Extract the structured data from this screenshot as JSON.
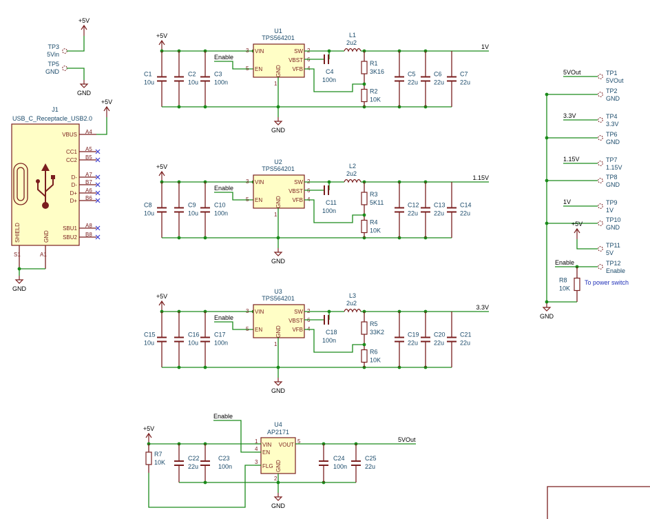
{
  "regulators": [
    {
      "ref": "U1",
      "part": "TPS564201",
      "enable": "Enable",
      "out_net": "1V",
      "l_ref": "L1",
      "l_val": "2u2",
      "cin": [
        {
          "ref": "C1",
          "val": "10u"
        },
        {
          "ref": "C2",
          "val": "10u"
        },
        {
          "ref": "C3",
          "val": "100n"
        }
      ],
      "cboot": {
        "ref": "C4",
        "val": "100n"
      },
      "rtop": {
        "ref": "R1",
        "val": "3K16"
      },
      "rbot": {
        "ref": "R2",
        "val": "10K"
      },
      "cout": [
        {
          "ref": "C5",
          "val": "22u"
        },
        {
          "ref": "C6",
          "val": "22u"
        },
        {
          "ref": "C7",
          "val": "22u"
        }
      ]
    },
    {
      "ref": "U2",
      "part": "TPS564201",
      "enable": "Enable",
      "out_net": "1.15V",
      "l_ref": "L2",
      "l_val": "2u2",
      "cin": [
        {
          "ref": "C8",
          "val": "10u"
        },
        {
          "ref": "C9",
          "val": "10u"
        },
        {
          "ref": "C10",
          "val": "100n"
        }
      ],
      "cboot": {
        "ref": "C11",
        "val": "100n"
      },
      "rtop": {
        "ref": "R3",
        "val": "5K11"
      },
      "rbot": {
        "ref": "R4",
        "val": "10K"
      },
      "cout": [
        {
          "ref": "C12",
          "val": "22u"
        },
        {
          "ref": "C13",
          "val": "22u"
        },
        {
          "ref": "C14",
          "val": "22u"
        }
      ]
    },
    {
      "ref": "U3",
      "part": "TPS564201",
      "enable": "Enable",
      "out_net": "3.3V",
      "l_ref": "L3",
      "l_val": "2u2",
      "cin": [
        {
          "ref": "C15",
          "val": "10u"
        },
        {
          "ref": "C16",
          "val": "10u"
        },
        {
          "ref": "C17",
          "val": "100n"
        }
      ],
      "cboot": {
        "ref": "C18",
        "val": "100n"
      },
      "rtop": {
        "ref": "R5",
        "val": "33K2"
      },
      "rbot": {
        "ref": "R6",
        "val": "10K"
      },
      "cout": [
        {
          "ref": "C19",
          "val": "22u"
        },
        {
          "ref": "C20",
          "val": "22u"
        },
        {
          "ref": "C21",
          "val": "22u"
        }
      ]
    }
  ],
  "reg_pins": {
    "vin": "VIN",
    "en": "EN",
    "sw": "SW",
    "vbst": "VBST",
    "vfb": "VFB",
    "gnd": "GND",
    "n_vin": "3",
    "n_en": "5",
    "n_sw": "2",
    "n_vbst": "6",
    "n_vfb": "4",
    "n_gnd": "1"
  },
  "switch": {
    "ref": "U4",
    "part": "AP2171",
    "enable": "Enable",
    "out_net": "5VOut",
    "pins": {
      "vin": "VIN",
      "en": "EN",
      "flg": "FLG",
      "gnd": "GND",
      "vout": "VOUT",
      "n_vin": "1",
      "n_en": "4",
      "n_flg": "3",
      "n_gnd": "2",
      "n_vout": "5"
    },
    "r": {
      "ref": "R7",
      "val": "10K"
    },
    "cin": [
      {
        "ref": "C22",
        "val": "22u"
      },
      {
        "ref": "C23",
        "val": "100n"
      }
    ],
    "cout": [
      {
        "ref": "C24",
        "val": "100n"
      },
      {
        "ref": "C25",
        "val": "22u"
      }
    ]
  },
  "power": {
    "p5v": "+5V",
    "gnd": "GND"
  },
  "top_tps": [
    {
      "ref": "TP3",
      "val": "5Vin"
    },
    {
      "ref": "TP5",
      "val": "GND"
    }
  ],
  "usb": {
    "ref": "J1",
    "part": "USB_C_Receptacle_USB2.0",
    "pins": [
      {
        "name": "VBUS",
        "num": "A4"
      },
      {
        "name": "CC1",
        "num": "A5"
      },
      {
        "name": "CC2",
        "num": "B5"
      },
      {
        "name": "D-",
        "num": "A7"
      },
      {
        "name": "D-",
        "num": "B7"
      },
      {
        "name": "D+",
        "num": "A6"
      },
      {
        "name": "D+",
        "num": "B6"
      },
      {
        "name": "SBU1",
        "num": "A8"
      },
      {
        "name": "SBU2",
        "num": "B8"
      }
    ],
    "shield": "SHIELD",
    "shield_num": "S1",
    "gnd": "GND",
    "gnd_num": "A1"
  },
  "testpoints": [
    {
      "ref": "TP1",
      "val": "5VOut",
      "net": "5VOut"
    },
    {
      "ref": "TP2",
      "val": "GND",
      "net": ""
    },
    {
      "ref": "TP4",
      "val": "3.3V",
      "net": "3.3V"
    },
    {
      "ref": "TP6",
      "val": "GND",
      "net": ""
    },
    {
      "ref": "TP7",
      "val": "1.15V",
      "net": "1.15V"
    },
    {
      "ref": "TP8",
      "val": "GND",
      "net": ""
    },
    {
      "ref": "TP9",
      "val": "1V",
      "net": "1V"
    },
    {
      "ref": "TP10",
      "val": "GND",
      "net": ""
    },
    {
      "ref": "TP11",
      "val": "5V",
      "net": ""
    },
    {
      "ref": "TP12",
      "val": "Enable",
      "net": "Enable"
    }
  ],
  "r8": {
    "ref": "R8",
    "val": "10K"
  },
  "note": "To power switch"
}
